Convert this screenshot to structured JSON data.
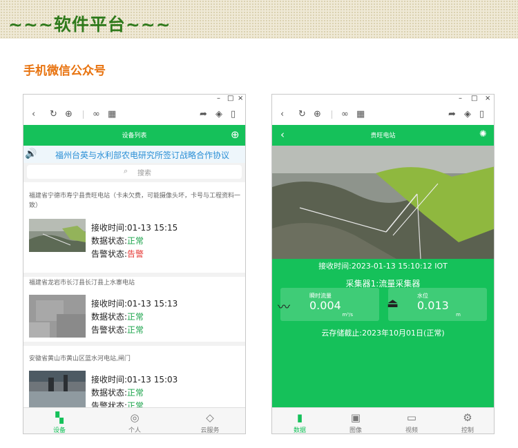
{
  "banner": {
    "title": "~~~软件平台~~~"
  },
  "section": {
    "title": "手机微信公众号"
  },
  "window_controls": {
    "minimize": "–",
    "maximize": "□",
    "close": "×"
  },
  "toolbar_icons": [
    "back-icon",
    "refresh-icon",
    "globe-icon",
    "link-icon",
    "qr-icon",
    "share-icon",
    "cube-icon",
    "phone-icon"
  ],
  "left_phone": {
    "title": "设备列表",
    "add_icon": "⊕",
    "notice": "福州台英与水利部农电研究所签订战略合作协议",
    "search_placeholder": "搜索",
    "devices": [
      {
        "name": "福建省宁德市寿宁县贵旺电站（卡未欠费，可能摄像头坏，卡号与工程资料一致）",
        "receive": "接收时间:01-13 15:15",
        "data_label": "数据状态:",
        "data_status": "正常",
        "alarm_label": "告警状态:",
        "alarm_status": "告警"
      },
      {
        "name": "福建省龙岩市长汀县长汀县上水寨电站",
        "receive": "接收时间:01-13 15:13",
        "data_label": "数据状态:",
        "data_status": "正常",
        "alarm_label": "告警状态:",
        "alarm_status": "正常"
      },
      {
        "name": "安徽省黄山市黄山区蓝水河电站,闸门",
        "receive": "接收时间:01-13 15:03",
        "data_label": "数据状态:",
        "data_status": "正常",
        "alarm_label": "告警状态:",
        "alarm_status": "正常"
      }
    ],
    "tabs": [
      {
        "label": "设备",
        "icon": "grid-icon",
        "active": true
      },
      {
        "label": "个人",
        "icon": "user-icon",
        "active": false
      },
      {
        "label": "云服务",
        "icon": "tag-icon",
        "active": false
      }
    ]
  },
  "right_phone": {
    "title": "贵旺电站",
    "receive_time": "接收时间:2023-01-13 15:10:12 IOT",
    "collector": "采集器1:流量采集器",
    "metrics": [
      {
        "label": "瞬时流量",
        "value": "0.004",
        "unit": "m³/s",
        "icon": "waveform-icon"
      },
      {
        "label": "水位",
        "value": "0.013",
        "unit": "m",
        "icon": "gauge-icon"
      }
    ],
    "cloud_storage": "云存储截止:2023年10月01日(正常)",
    "tabs": [
      {
        "label": "数据",
        "icon": "bar-chart-icon",
        "active": true
      },
      {
        "label": "图像",
        "icon": "image-icon",
        "active": false
      },
      {
        "label": "视频",
        "icon": "monitor-icon",
        "active": false
      },
      {
        "label": "控制",
        "icon": "gear-icon",
        "active": false
      }
    ]
  },
  "colors": {
    "brand_green": "#15c15a",
    "status_ok": "#1aa34a",
    "status_alarm": "#e53935",
    "section_orange": "#e8730f",
    "notice_blue": "#2a8fd6"
  }
}
